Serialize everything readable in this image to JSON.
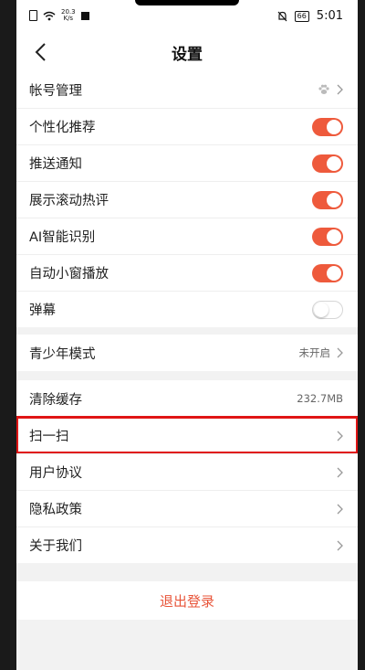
{
  "status_bar": {
    "network_speed_top": "20.3",
    "network_speed_unit": "K/s",
    "battery": "66",
    "time": "5:01"
  },
  "header": {
    "title": "设置",
    "back_icon": "chevron-left-icon"
  },
  "group1": {
    "items": [
      {
        "label": "帐号管理",
        "control": "chevron",
        "icon": "paw-icon"
      },
      {
        "label": "个性化推荐",
        "toggle": "on"
      },
      {
        "label": "推送通知",
        "toggle": "on"
      },
      {
        "label": "展示滚动热评",
        "toggle": "on"
      },
      {
        "label": "AI智能识别",
        "toggle": "on"
      },
      {
        "label": "自动小窗播放",
        "toggle": "on"
      },
      {
        "label": "弹幕",
        "toggle": "off"
      }
    ]
  },
  "group2": {
    "items": [
      {
        "label": "青少年模式",
        "value": "未开启"
      }
    ]
  },
  "group3": {
    "items": [
      {
        "label": "清除缓存",
        "value": "232.7MB"
      },
      {
        "label": "扫一扫"
      },
      {
        "label": "用户协议"
      },
      {
        "label": "隐私政策"
      },
      {
        "label": "关于我们"
      }
    ]
  },
  "logout": {
    "label": "退出登录"
  },
  "colors": {
    "accent": "#ee5a3c",
    "highlight_box": "#e01515",
    "logout_text": "#e8553a"
  }
}
